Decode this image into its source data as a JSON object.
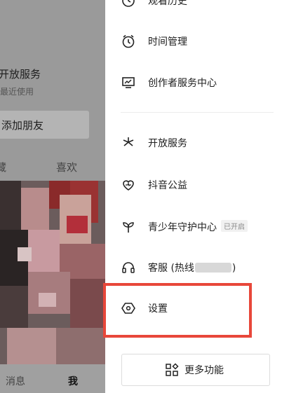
{
  "background": {
    "service_title": "开放服务",
    "service_sub": "最近使用",
    "add_friend": "添加朋友",
    "tab_left": "藏",
    "tab_right": "喜欢",
    "nav_messages": "消息",
    "nav_me": "我"
  },
  "drawer": {
    "items": [
      {
        "label": "观看历史",
        "icon": "clock-history-icon"
      },
      {
        "label": "时间管理",
        "icon": "alarm-clock-icon"
      },
      {
        "label": "创作者服务中心",
        "icon": "chart-monitor-icon"
      },
      {
        "label": "开放服务",
        "icon": "asterisk-icon"
      },
      {
        "label": "抖音公益",
        "icon": "heart-icon"
      },
      {
        "label": "青少年守护中心",
        "icon": "sprout-icon",
        "badge": "已开启"
      },
      {
        "label": "客服 (热线",
        "label_suffix": ")",
        "icon": "headset-icon"
      },
      {
        "label": "设置",
        "icon": "hexagon-settings-icon"
      }
    ],
    "more_button": {
      "label": "更多功能",
      "icon": "grid-apps-icon"
    }
  },
  "colors": {
    "highlight": "#e8473a",
    "dim_overlay": "#9a9a9a"
  }
}
